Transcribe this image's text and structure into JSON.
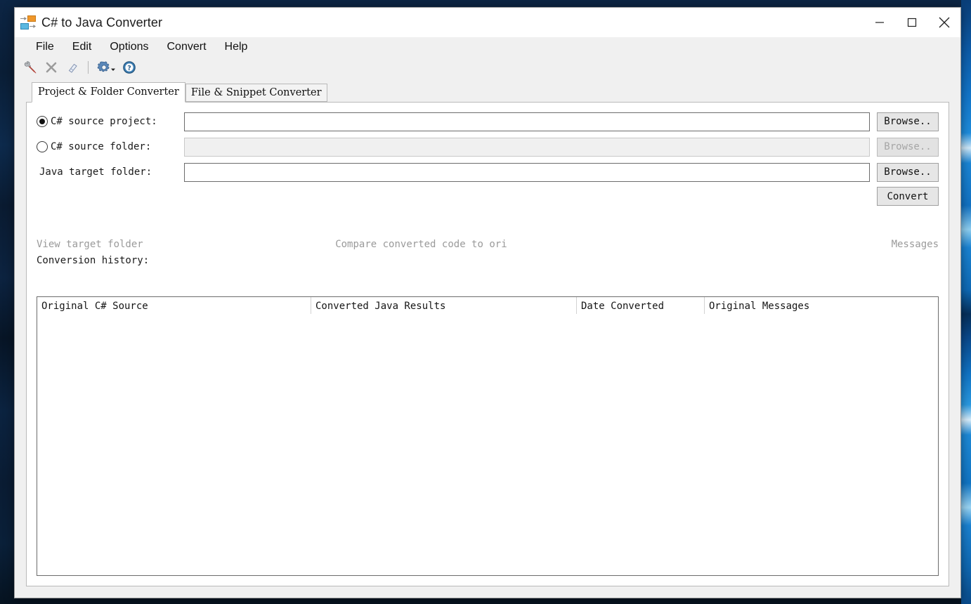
{
  "window": {
    "title": "C# to Java Converter",
    "icon": "app-convert-icon",
    "controls": {
      "minimize": "minimize-icon",
      "maximize": "maximize-icon",
      "close": "close-icon"
    }
  },
  "menubar": {
    "items": [
      {
        "label": "File"
      },
      {
        "label": "Edit"
      },
      {
        "label": "Options"
      },
      {
        "label": "Convert"
      },
      {
        "label": "Help"
      }
    ]
  },
  "toolbar": {
    "buttons": [
      {
        "icon": "wrench-screwdriver-icon",
        "enabled": true
      },
      {
        "icon": "cancel-x-icon",
        "enabled": false
      },
      {
        "icon": "eraser-icon",
        "enabled": true
      },
      {
        "icon": "gear-dropdown-icon",
        "enabled": true
      },
      {
        "icon": "help-question-icon",
        "enabled": true
      }
    ]
  },
  "tabs": [
    {
      "label": "Project & Folder Converter",
      "selected": true
    },
    {
      "label": "File & Snippet Converter",
      "selected": false
    }
  ],
  "form": {
    "rows": [
      {
        "label": "C# source project:",
        "radio": true,
        "radio_selected": true,
        "value": "",
        "placeholder": "",
        "enabled": true,
        "button": "Browse.."
      },
      {
        "label": "C# source folder:",
        "radio": true,
        "radio_selected": false,
        "value": "",
        "placeholder": "",
        "enabled": false,
        "button": "Browse.."
      },
      {
        "label": "Java target folder:",
        "radio": false,
        "radio_selected": false,
        "value": "",
        "placeholder": "",
        "enabled": true,
        "button": "Browse.."
      }
    ],
    "convert_button": "Convert"
  },
  "links": {
    "view_target_folder": "View target folder",
    "compare": "Compare converted code to ori",
    "messages": "Messages"
  },
  "history": {
    "label": "Conversion history:",
    "columns": [
      "Original C# Source",
      "Converted Java Results",
      "Date Converted",
      "Original Messages"
    ],
    "rows": []
  },
  "colors": {
    "accent_orange": "#f0972a",
    "accent_blue": "#5cb8e0",
    "gear_blue": "#4a77a8",
    "help_blue": "#2c6fa8",
    "close_hover": "#e81123",
    "disabled_text": "#9a9a9a"
  }
}
